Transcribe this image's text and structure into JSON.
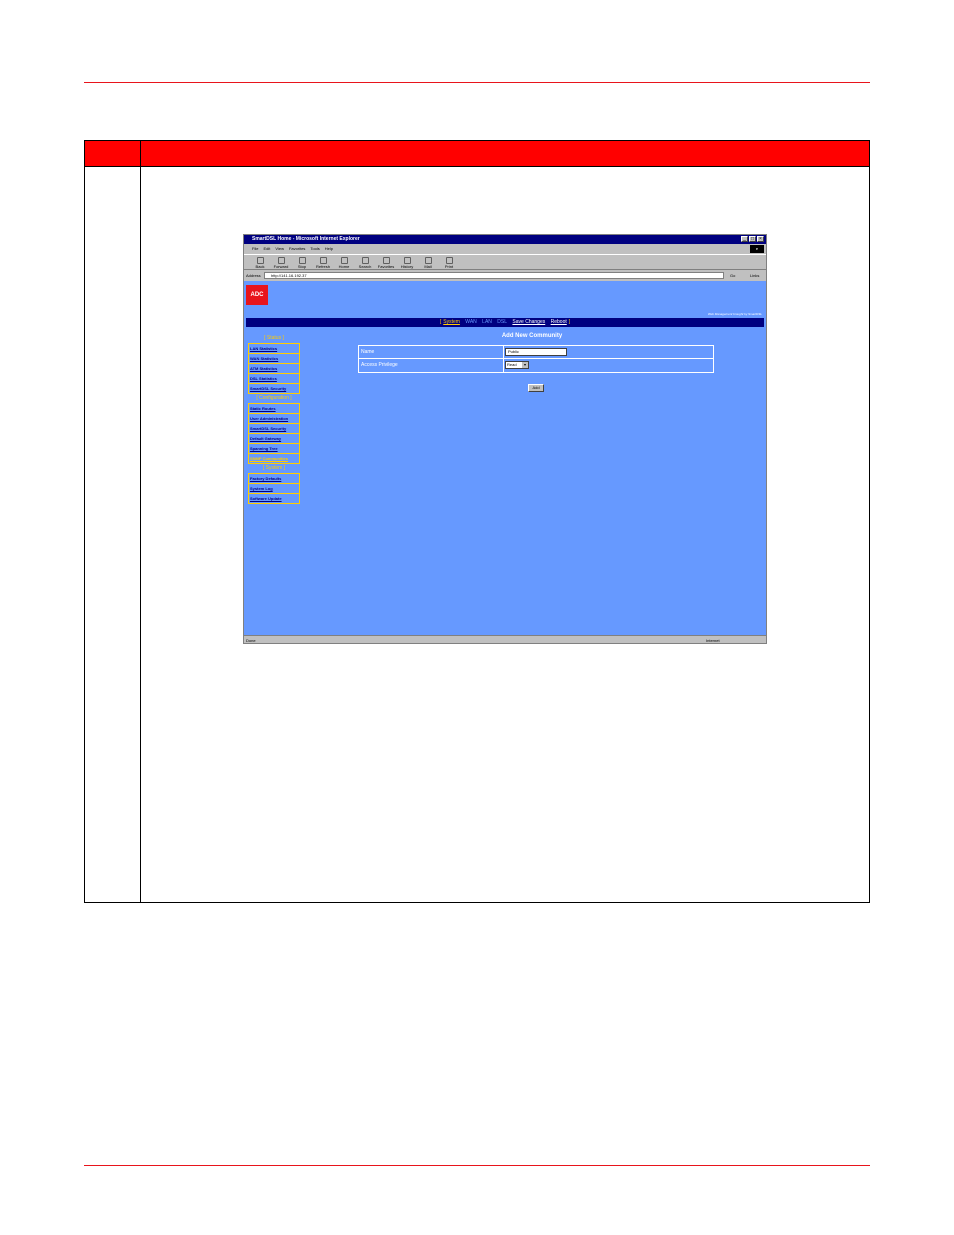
{
  "browser": {
    "title": "SmartDSL Home - Microsoft Internet Explorer",
    "menus": [
      "File",
      "Edit",
      "View",
      "Favorites",
      "Tools",
      "Help"
    ],
    "toolbar": [
      "Back",
      "Forward",
      "Stop",
      "Refresh",
      "Home",
      "Search",
      "Favorites",
      "History",
      "Mail",
      "Print"
    ],
    "address_label": "Address",
    "address_value": "http://141.16.192.37",
    "go_label": "Go",
    "links_label": "Links",
    "status_text": "Done",
    "zone_text": "Internet"
  },
  "app": {
    "logo_text": "ADC",
    "tagline": "Web Management brought by SmartDSL",
    "nav": [
      "System",
      "WAN",
      "LAN",
      "DSL",
      "Save Changes",
      "Reboot"
    ],
    "sidebar": {
      "status_head": "[ Status ]",
      "status_items": [
        "LAN Statistics",
        "WAN Statistics",
        "ATM Statistics",
        "DSL Statistics",
        "SmartDSL Security"
      ],
      "config_head": "[ Configuration ]",
      "config_items": [
        "Static Routes",
        "User Administration",
        "SmartDSL Security",
        "Default Gateway",
        "Spanning Tree",
        "SNMP Communities"
      ],
      "system_head": "[ System ]",
      "system_items": [
        "Factory Defaults",
        "System Log",
        "Software Update"
      ]
    },
    "form": {
      "title": "Add New Community",
      "name_label": "Name",
      "name_value": "Public",
      "privilege_label": "Access Privilege",
      "privilege_value": "Read",
      "add_button": "Add"
    }
  }
}
